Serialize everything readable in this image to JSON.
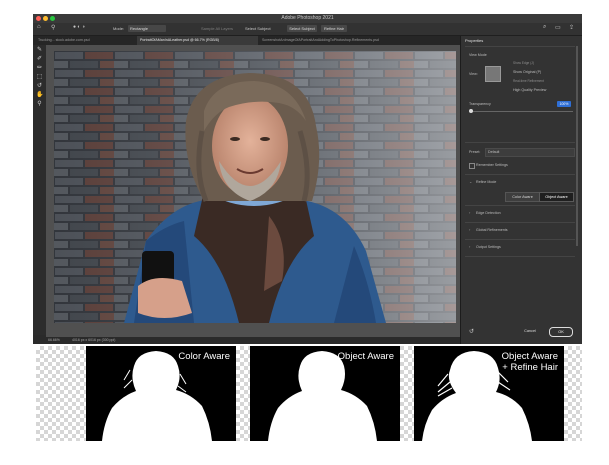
{
  "window": {
    "title": "Adobe Photoshop 2021",
    "traffic_colors": [
      "#ff5f57",
      "#febc2e",
      "#28c840"
    ]
  },
  "options_bar": {
    "mode_label": "Mode:",
    "mode_value": "Rectangle",
    "sample_label": "Sample All Layers",
    "select_subject_label": "Select Subject",
    "select_subject_btn": "Select Subject",
    "refine_hair_btn": "Refine Hair"
  },
  "tabs": [
    {
      "label": "Trucking... stock.adobe.com.psd",
      "active": false
    },
    {
      "label": "PortraitOfAManInALeather.psd @ 66.7% (RGB/8)",
      "active": true
    },
    {
      "label": "ScreenshotAnImageOfAPortraitAndAddingToPhotoshop.Refinements.psd",
      "active": false
    }
  ],
  "statusbar": {
    "zoom": "66.66%",
    "doc_info": "4016 px x 6016 px (300 ppi)"
  },
  "properties": {
    "title": "Properties",
    "view_mode_label": "View Mode",
    "view_label": "View:",
    "show_edge": "Show Edge (J)",
    "show_original": "Show Original (P)",
    "realtime_refinement": "Real-time Refinement",
    "high_quality_preview": "High Quality Preview",
    "transparency_label": "Transparency",
    "transparency_value": "100%",
    "transparency_fraction": 0.0,
    "preset_label": "Preset:",
    "preset_value": "Default",
    "remember_settings": "Remember Settings",
    "refine_mode_label": "Refine Mode",
    "color_aware": "Color Aware",
    "object_aware": "Object Aware",
    "sections": [
      "Edge Detection",
      "Global Refinements",
      "Output Settings"
    ],
    "cancel": "Cancel",
    "ok": "OK"
  },
  "comparison": [
    {
      "caption_line1": "Color Aware",
      "caption_line2": ""
    },
    {
      "caption_line1": "Object Aware",
      "caption_line2": ""
    },
    {
      "caption_line1": "Object Aware",
      "caption_line2": "+ Refine Hair"
    }
  ]
}
